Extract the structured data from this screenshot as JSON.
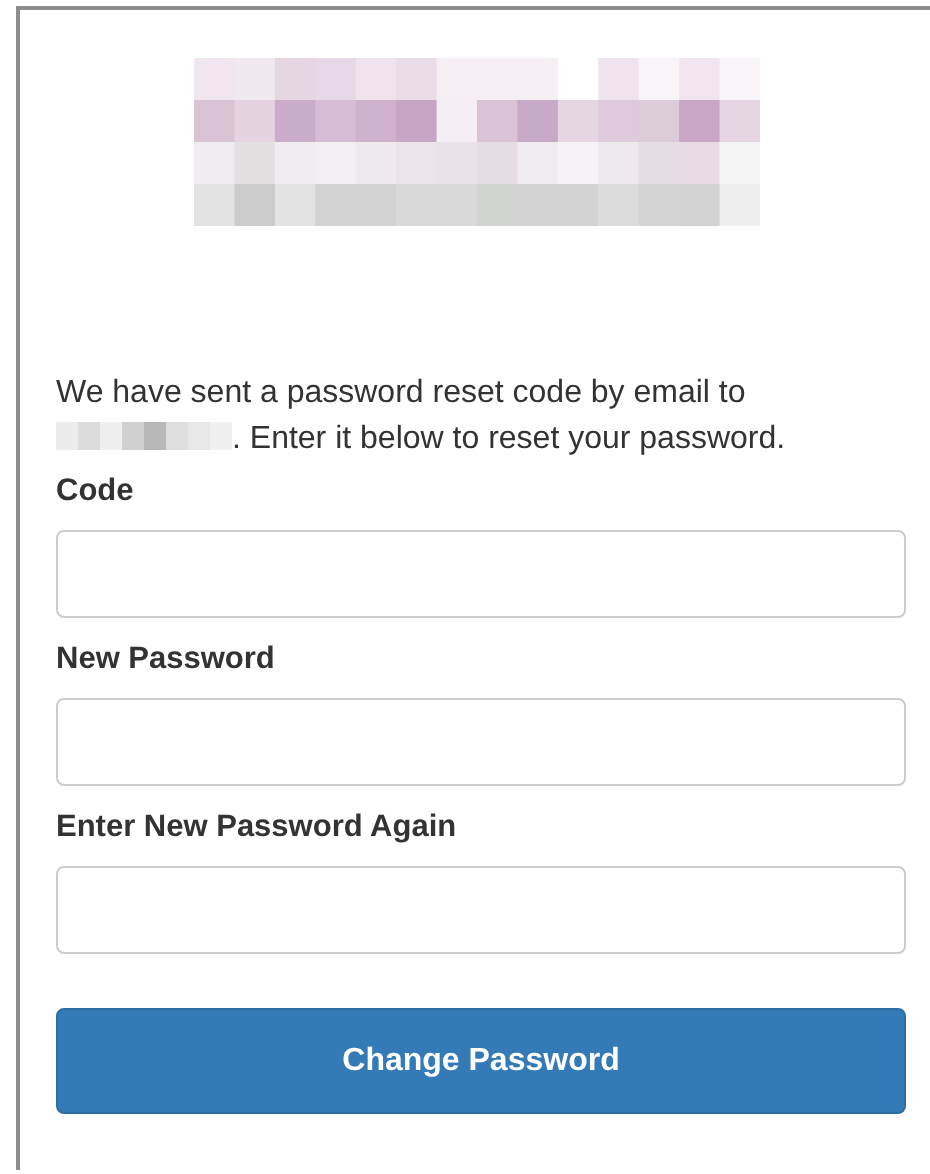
{
  "message": {
    "before": "We have sent a password reset code by email to",
    "after": ". Enter it below to reset your password."
  },
  "fields": [
    {
      "label": "Code"
    },
    {
      "label": "New Password"
    },
    {
      "label": "Enter New Password Again"
    }
  ],
  "submit": {
    "label": "Change Password"
  }
}
